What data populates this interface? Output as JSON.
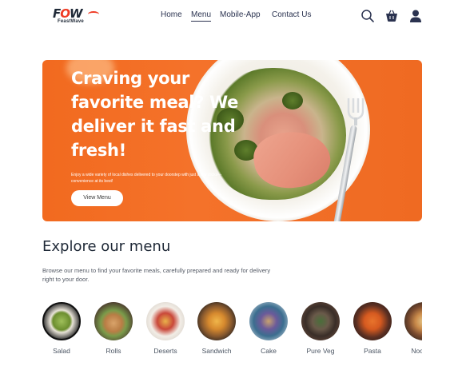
{
  "brand": {
    "logo_text_1": "F",
    "logo_text_2": "O",
    "logo_text_3": "W",
    "logo_sub": "FeastWave"
  },
  "nav": {
    "items": [
      {
        "label": "Home",
        "active": false
      },
      {
        "label": "Menu",
        "active": true
      },
      {
        "label": "Mobile-App",
        "active": false
      },
      {
        "label": "Contact Us",
        "active": false
      }
    ],
    "icons": [
      "search-icon",
      "basket-icon",
      "user-icon"
    ]
  },
  "hero": {
    "title": "Craving your favorite meal? We deliver it fast and fresh!",
    "subtitle": "Enjoy a wide variety of local dishes delivered to your doorstep with just a few clicks—convenience at its best!",
    "button_label": "View Menu"
  },
  "explore": {
    "title": "Explore our menu",
    "description": "Browse our menu to find your favorite meals, carefully prepared and ready for delivery right to your door."
  },
  "categories": [
    {
      "label": "Salad"
    },
    {
      "label": "Rolls"
    },
    {
      "label": "Deserts"
    },
    {
      "label": "Sandwich"
    },
    {
      "label": "Cake"
    },
    {
      "label": "Pure Veg"
    },
    {
      "label": "Pasta"
    },
    {
      "label": "Noodles"
    }
  ],
  "colors": {
    "accent": "#ef6a22",
    "brand_red": "#ef3b24",
    "nav_text": "#2b3350"
  }
}
